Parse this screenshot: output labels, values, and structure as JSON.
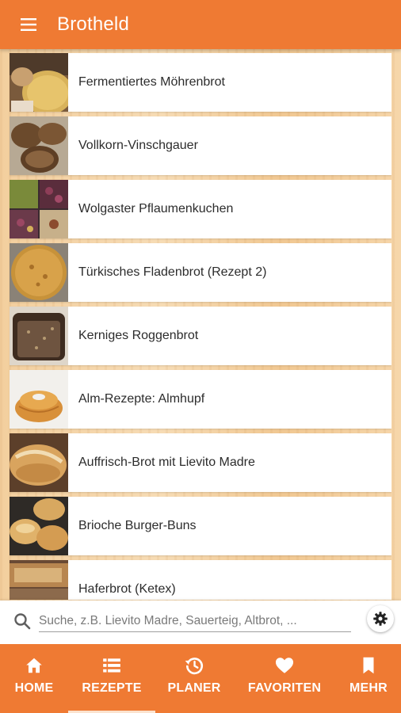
{
  "app_bar": {
    "title": "Brotheld",
    "menu_icon": "hamburger-menu-icon"
  },
  "recipes": [
    {
      "label": "Fermentiertes Möhrenbrot"
    },
    {
      "label": "Vollkorn-Vinschgauer"
    },
    {
      "label": "Wolgaster Pflaumenkuchen"
    },
    {
      "label": "Türkisches Fladenbrot (Rezept 2)"
    },
    {
      "label": "Kerniges Roggenbrot"
    },
    {
      "label": "Alm-Rezepte: Almhupf"
    },
    {
      "label": "Auffrisch-Brot mit Lievito Madre"
    },
    {
      "label": "Brioche Burger-Buns"
    },
    {
      "label": "Haferbrot (Ketex)"
    }
  ],
  "search": {
    "placeholder": "Suche, z.B. Lievito Madre, Sauerteig, Altbrot, ...",
    "value": "",
    "icon": "search-icon",
    "settings_icon": "gear-icon"
  },
  "bottom_nav": {
    "active": "REZEPTE",
    "items": [
      {
        "label": "HOME",
        "icon": "home-icon"
      },
      {
        "label": "REZEPTE",
        "icon": "list-icon"
      },
      {
        "label": "PLANER",
        "icon": "history-icon"
      },
      {
        "label": "FAVORITEN",
        "icon": "heart-icon"
      },
      {
        "label": "MEHR",
        "icon": "bookmark-icon"
      }
    ]
  },
  "colors": {
    "primary": "#ef7a33",
    "card": "#ffffff",
    "wood": "#f4d2a6"
  }
}
